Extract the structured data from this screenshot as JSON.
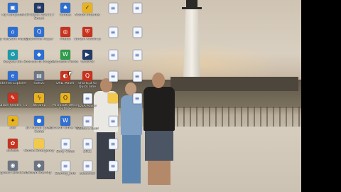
{
  "desktop": {
    "colors": {
      "label_text": "#ffffff",
      "side_bar": "#000000"
    },
    "icons": [
      {
        "label": "My Computer",
        "glyph": "computer-icon",
        "symbol": "▣",
        "style": "ic-blue"
      },
      {
        "label": "My Network Places",
        "glyph": "network-icon",
        "symbol": "⌂",
        "style": "ic-blue"
      },
      {
        "label": "Recycle Bin",
        "glyph": "recycle-bin-icon",
        "symbol": "♻",
        "style": "ic-teal"
      },
      {
        "label": "Internet Explorer",
        "glyph": "ie-icon",
        "symbol": "e",
        "style": "ic-blue"
      },
      {
        "label": "Adobe Reader 7.0",
        "glyph": "pdf-icon",
        "symbol": "✎",
        "style": "ic-red"
      },
      {
        "label": "AIM",
        "glyph": "aim-icon",
        "symbol": "✦",
        "style": "ic-yellow"
      },
      {
        "label": "AllPaint",
        "glyph": "paint-icon",
        "symbol": "✿",
        "style": "ic-red"
      },
      {
        "label": "Logitech QuickCam",
        "glyph": "webcam-icon",
        "symbol": "◉",
        "style": "ic-gray"
      },
      {
        "label": "NETGEAR WG111T Smart",
        "glyph": "wifi-icon",
        "symbol": "≋",
        "style": "ic-dark"
      },
      {
        "label": "QuickTime Player",
        "glyph": "quicktime-icon",
        "symbol": "Q",
        "style": "ic-blue"
      },
      {
        "label": "Shortcut to Dragon",
        "glyph": "app-icon",
        "symbol": "◆",
        "style": "ic-blue"
      },
      {
        "label": "ssdsvc",
        "glyph": "program-icon",
        "symbol": "▤",
        "style": "ic-gray"
      },
      {
        "label": "Winamp",
        "glyph": "winamp-icon",
        "symbol": "ϟ",
        "style": "ic-yellow"
      },
      {
        "label": "3D Pinball Space Cadet",
        "glyph": "pinball-icon",
        "symbol": "●",
        "style": "ic-blue"
      },
      {
        "label": "Gordie Emergency",
        "glyph": "folder-icon",
        "symbol": "",
        "style": "ic-folder"
      },
      {
        "label": "Nissan Eternity",
        "glyph": "app-icon",
        "symbol": "◆",
        "style": "ic-gray"
      },
      {
        "label": "Games",
        "glyph": "games-icon",
        "symbol": "♠",
        "style": "ic-blue"
      },
      {
        "label": "Firefox",
        "glyph": "firefox-icon",
        "symbol": "◎",
        "style": "ic-red"
      },
      {
        "label": "Microsoft Works",
        "glyph": "works-icon",
        "symbol": "W",
        "style": "ic-green"
      },
      {
        "label": "DVD Maker",
        "glyph": "dvd-icon",
        "symbol": "◐",
        "style": "ic-red"
      },
      {
        "label": "Microsoft Office Outlook",
        "glyph": "outlook-icon",
        "symbol": "O",
        "style": "ic-yellow"
      },
      {
        "label": "Microsoft Office Word",
        "glyph": "word-icon",
        "symbol": "W",
        "style": "ic-blue"
      },
      {
        "label": "Sony Video",
        "glyph": "document-icon",
        "symbol": "≡",
        "style": "ic-doc"
      },
      {
        "label": "Eternity_Info",
        "glyph": "document-icon",
        "symbol": "≡",
        "style": "ic-doc"
      },
      {
        "label": "Norton Internet",
        "glyph": "norton-icon",
        "symbol": "✓",
        "style": "ic-yellow"
      },
      {
        "label": "Norton AntiVirus",
        "glyph": "antivirus-icon",
        "symbol": "⛨",
        "style": "ic-red"
      },
      {
        "label": "WinDVD",
        "glyph": "windvd-icon",
        "symbol": "▶",
        "style": "ic-dark"
      },
      {
        "label": "Shortcut to QuickTime",
        "glyph": "shortcut-icon",
        "symbol": "Q",
        "style": "ic-red"
      },
      {
        "label": "IDEA Maker",
        "glyph": "document-icon",
        "symbol": "≡",
        "style": "ic-doc"
      },
      {
        "label": "Gordie's Stuff",
        "glyph": "document-icon",
        "symbol": "≡",
        "style": "ic-doc"
      },
      {
        "label": "2011",
        "glyph": "document-icon",
        "symbol": "≡",
        "style": "ic-doc"
      },
      {
        "label": "sacoche3",
        "glyph": "document-icon",
        "symbol": "≡",
        "style": "ic-doc"
      },
      {
        "label": "",
        "glyph": "document-icon",
        "symbol": "≡",
        "style": "ic-doc"
      },
      {
        "label": "",
        "glyph": "document-icon",
        "symbol": "≡",
        "style": "ic-doc"
      },
      {
        "label": "",
        "glyph": "document-icon",
        "symbol": "≡",
        "style": "ic-doc"
      },
      {
        "label": "",
        "glyph": "document-icon",
        "symbol": "≡",
        "style": "ic-doc"
      },
      {
        "label": "",
        "glyph": "folder-icon",
        "symbol": "",
        "style": "ic-folder"
      },
      {
        "label": "",
        "glyph": "document-icon",
        "symbol": "≡",
        "style": "ic-doc"
      },
      {
        "label": "",
        "glyph": "document-icon",
        "symbol": "≡",
        "style": "ic-doc"
      },
      {
        "label": "",
        "glyph": "document-icon",
        "symbol": "≡",
        "style": "ic-doc"
      },
      {
        "label": "",
        "glyph": "document-icon",
        "symbol": "≡",
        "style": "ic-doc"
      },
      {
        "label": "",
        "glyph": "document-icon",
        "symbol": "≡",
        "style": "ic-doc"
      },
      {
        "label": "",
        "glyph": "document-icon",
        "symbol": "≡",
        "style": "ic-doc"
      },
      {
        "label": "",
        "glyph": "document-icon",
        "symbol": "≡",
        "style": "ic-doc"
      },
      {
        "label": "",
        "glyph": "document-icon",
        "symbol": "≡",
        "style": "ic-doc"
      }
    ]
  }
}
